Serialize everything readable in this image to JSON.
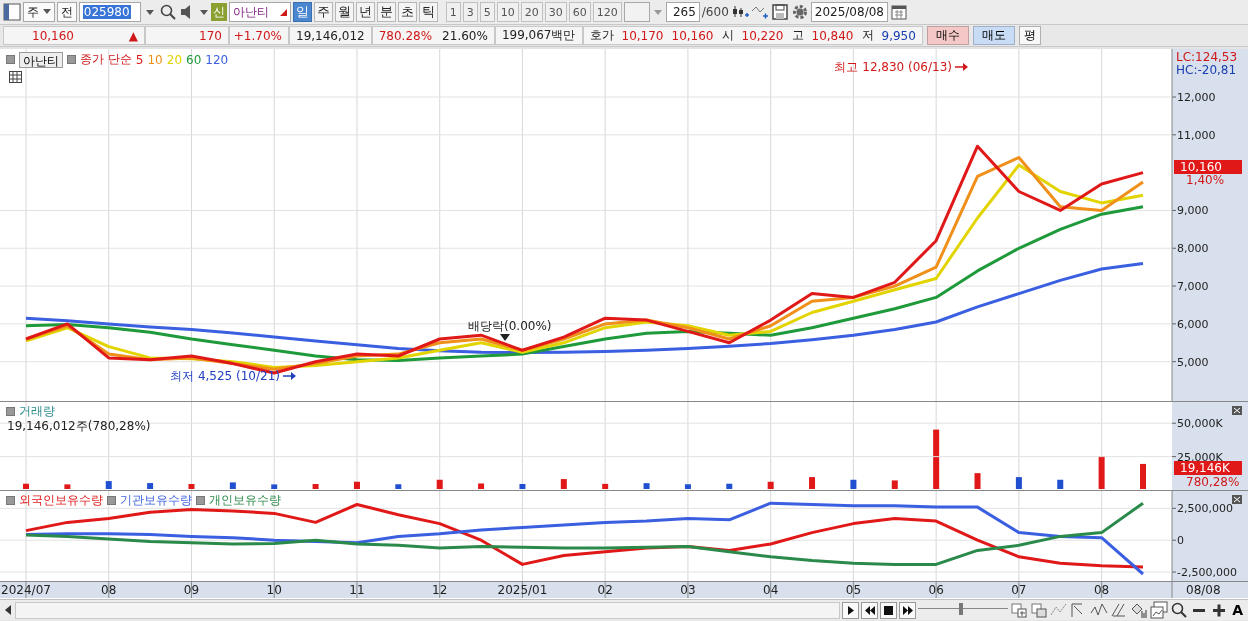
{
  "toolbar": {
    "market": "주",
    "prev": "전",
    "code": "025980",
    "new_badge": "신",
    "name": "아난티",
    "periods": [
      {
        "label": "일",
        "selected": true
      },
      {
        "label": "주",
        "selected": false
      },
      {
        "label": "월",
        "selected": false
      },
      {
        "label": "년",
        "selected": false
      },
      {
        "label": "분",
        "selected": false
      },
      {
        "label": "초",
        "selected": false
      },
      {
        "label": "틱",
        "selected": false
      }
    ],
    "intervals": [
      "1",
      "3",
      "5",
      "10",
      "20",
      "30",
      "60",
      "120"
    ],
    "count": "265",
    "max": "/600",
    "date": "2025/08/08"
  },
  "quote": {
    "price": "10,160",
    "arrow": "▲",
    "change": "170",
    "change_pct": "+1.70%",
    "volume": "19,146,012",
    "volume_pct": "780.28%",
    "turnover": "21.60%",
    "amount": "199,067백만",
    "bid_ask_label": "호가",
    "ask": "10,170",
    "bid": "10,160",
    "open_label": "시",
    "open": "10,220",
    "high_label": "고",
    "high": "10,840",
    "low_label": "저",
    "low": "9,950",
    "buy": "매수",
    "sell": "매도",
    "eval": "평"
  },
  "price_panel": {
    "stock_button": "아난티",
    "indicator": "종가 단순",
    "lc": "LC:124,53",
    "hc": "HC:-20,81",
    "current_price": "10,160",
    "current_change": "1,40%",
    "chart_data": {
      "type": "line",
      "grid": true,
      "categories": [
        null,
        null,
        null,
        null,
        null,
        null,
        null,
        null,
        null,
        null,
        null,
        null,
        null,
        null,
        null,
        null,
        null,
        null,
        null,
        null,
        null,
        null,
        null,
        null,
        null,
        null,
        null,
        null
      ],
      "ylim": [
        3960,
        13270
      ],
      "yticks": [
        {
          "value": 5000,
          "label": "5,000"
        },
        {
          "value": 6000,
          "label": "6,000"
        },
        {
          "value": 7000,
          "label": "7,000"
        },
        {
          "value": 8000,
          "label": "8,000"
        },
        {
          "value": 9000,
          "label": "9,000"
        },
        {
          "value": 11000,
          "label": "11,000"
        },
        {
          "value": 12000,
          "label": "12,000"
        }
      ],
      "series": [
        {
          "name": "120",
          "color": "#3a5fe0",
          "values": [
            6150,
            6080,
            6000,
            5920,
            5850,
            5760,
            5650,
            5550,
            5450,
            5350,
            5290,
            5250,
            5240,
            5250,
            5270,
            5300,
            5350,
            5410,
            5480,
            5580,
            5700,
            5850,
            6050,
            6450,
            6800,
            7150,
            7450,
            7600
          ]
        },
        {
          "name": "60",
          "color": "#1f9a3a",
          "values": [
            5950,
            5980,
            5900,
            5780,
            5600,
            5450,
            5300,
            5150,
            5050,
            5030,
            5100,
            5150,
            5200,
            5400,
            5600,
            5750,
            5800,
            5750,
            5700,
            5900,
            6150,
            6400,
            6700,
            7400,
            8000,
            8500,
            8900,
            9100
          ]
        },
        {
          "name": "20",
          "color": "#e2d400",
          "values": [
            5550,
            5900,
            5400,
            5100,
            5080,
            5000,
            4850,
            4900,
            5000,
            5100,
            5300,
            5500,
            5250,
            5500,
            5900,
            6050,
            5950,
            5700,
            5800,
            6300,
            6600,
            6900,
            7200,
            8800,
            10200,
            9500,
            9200,
            9400
          ]
        },
        {
          "name": "10",
          "color": "#f0901a",
          "values": [
            5600,
            5950,
            5200,
            5050,
            5100,
            4950,
            4800,
            4950,
            5150,
            5200,
            5500,
            5600,
            5300,
            5600,
            6000,
            6100,
            5900,
            5600,
            5950,
            6600,
            6700,
            7000,
            7500,
            9900,
            10400,
            9100,
            9000,
            9750
          ]
        },
        {
          "name": "5",
          "color": "#e01818",
          "values": [
            5600,
            6000,
            5100,
            5050,
            5150,
            4950,
            4700,
            5000,
            5200,
            5150,
            5600,
            5700,
            5300,
            5650,
            6150,
            6100,
            5800,
            5500,
            6100,
            6800,
            6700,
            7100,
            8200,
            10700,
            9500,
            9000,
            9700,
            10000
          ]
        }
      ],
      "annotations": [
        "최고 12,830 (06/13)",
        "최저 4,525 (10/21)",
        "배당락(0.00%)"
      ]
    }
  },
  "volume_panel": {
    "summary": "19,146,012주(780,28%)",
    "current": "19,146K",
    "current_pct": "780,28%",
    "chart_data": {
      "type": "bar",
      "grid": true,
      "ylim": [
        0,
        65900
      ],
      "yticks": [
        {
          "value": 25000,
          "label": "25,000K"
        },
        {
          "value": 50000,
          "label": "50,000K"
        }
      ],
      "categories": [
        null,
        null,
        null,
        null,
        null,
        null,
        null,
        null,
        null,
        null,
        null,
        null,
        null,
        null,
        null,
        null,
        null,
        null,
        null,
        null,
        null,
        null,
        null,
        null,
        null,
        null,
        null,
        null
      ],
      "series": [
        {
          "name": "거래량",
          "values": [
            4000,
            3500,
            6000,
            4500,
            3800,
            5000,
            3500,
            3800,
            5500,
            3600,
            7000,
            4200,
            3800,
            7500,
            3900,
            4400,
            3600,
            4000,
            5500,
            9000,
            7000,
            6500,
            45000,
            12000,
            9000,
            7000,
            25000,
            19000
          ]
        }
      ]
    }
  },
  "holdings_panel": {
    "chart_data": {
      "type": "line",
      "grid": true,
      "categories": [
        "2024/07",
        null,
        "08",
        null,
        "09",
        null,
        "10",
        null,
        "11",
        null,
        "12",
        null,
        "2025/01",
        null,
        "02",
        null,
        "03",
        null,
        "04",
        null,
        "05",
        null,
        "06",
        null,
        "07",
        null,
        "08",
        null
      ],
      "ylim": [
        -3200000,
        3860000
      ],
      "yticks": [
        {
          "value": -2500000,
          "label": "-2,500,000"
        },
        {
          "value": 0,
          "label": "0"
        },
        {
          "value": 2500000,
          "label": "2,500,000"
        }
      ],
      "series": [
        {
          "name": "외국인보유수량",
          "color": "#e01818",
          "values": [
            750000,
            1400000,
            1700000,
            2200000,
            2400000,
            2300000,
            2100000,
            1400000,
            2800000,
            2000000,
            1300000,
            0,
            -1900000,
            -1200000,
            -900000,
            -600000,
            -500000,
            -800000,
            -300000,
            600000,
            1300000,
            1700000,
            1500000,
            0,
            -1300000,
            -1800000,
            -2000000,
            -2100000
          ]
        },
        {
          "name": "기관보유수량",
          "color": "#3a5fe0",
          "values": [
            450000,
            500000,
            500000,
            450000,
            300000,
            200000,
            0,
            -100000,
            -200000,
            300000,
            500000,
            800000,
            1000000,
            1200000,
            1400000,
            1500000,
            1700000,
            1600000,
            2900000,
            2800000,
            2700000,
            2700000,
            2600000,
            2600000,
            600000,
            300000,
            200000,
            -2650000
          ]
        },
        {
          "name": "개인보유수량",
          "color": "#2a8a4a",
          "values": [
            400000,
            300000,
            100000,
            -100000,
            -200000,
            -300000,
            -250000,
            0,
            -300000,
            -400000,
            -600000,
            -500000,
            -550000,
            -600000,
            -600000,
            -550000,
            -500000,
            -900000,
            -1300000,
            -1600000,
            -1800000,
            -1900000,
            -1900000,
            -800000,
            -400000,
            300000,
            600000,
            2900000
          ]
        }
      ]
    }
  },
  "x_axis": {
    "current_date": "08/08"
  },
  "bottom_bar": {
    "slider": {
      "level": 0.47
    },
    "font_button": "A"
  }
}
